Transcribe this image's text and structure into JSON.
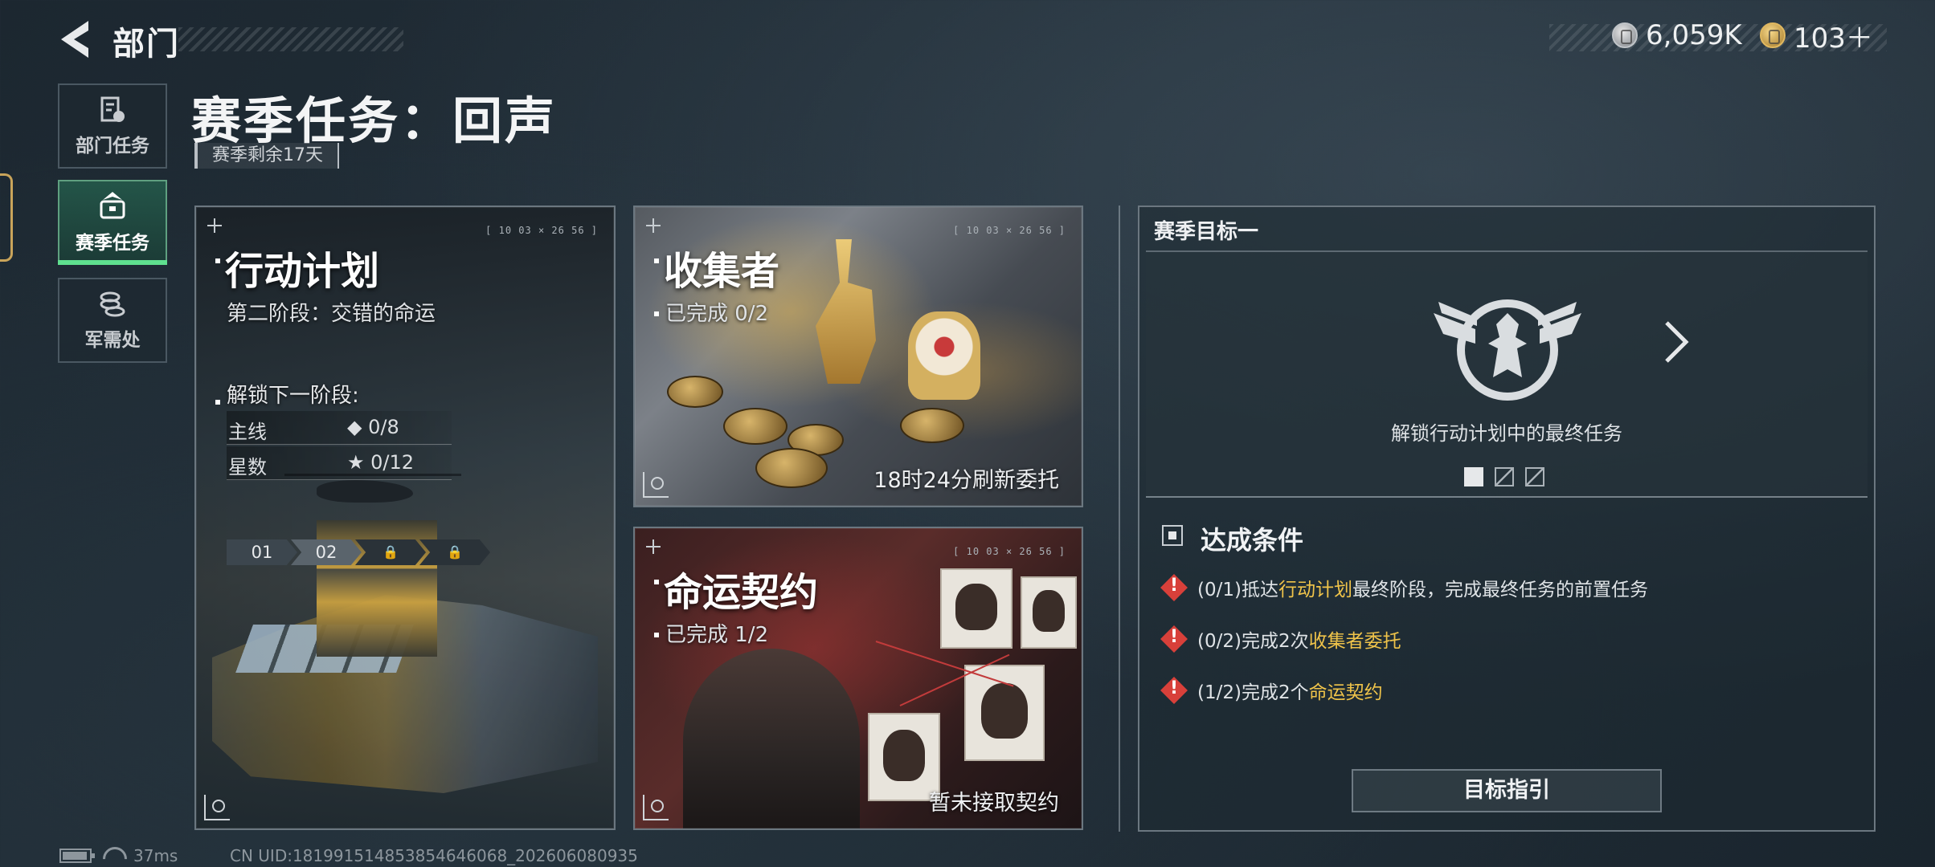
{
  "header": {
    "section_title": "部门",
    "currency": [
      {
        "icon": "silver-coin-icon",
        "value": "6,059K"
      },
      {
        "icon": "gold-coin-icon",
        "value": "103＋"
      }
    ]
  },
  "nav": {
    "items": [
      {
        "label": "部门任务",
        "icon": "task-clipboard-icon",
        "active": false
      },
      {
        "label": "赛季任务",
        "icon": "briefcase-icon",
        "active": true
      },
      {
        "label": "军需处",
        "icon": "coin-stack-icon",
        "active": false
      }
    ]
  },
  "page": {
    "title": "赛季任务：回声",
    "remaining": "赛季剩余17天"
  },
  "cards": {
    "operation": {
      "code": "[ 10 03  × 26 56 ]",
      "title": "行动计划",
      "stage": "第二阶段：交错的命运",
      "phases": [
        "01",
        "02",
        "🔒",
        "🔒"
      ],
      "unlock_label": "解锁下一阶段:",
      "main_label": "主线",
      "main_value": "◆ 0/8",
      "stars_label": "星数",
      "stars_value": "★ 0/12"
    },
    "collector": {
      "code": "[ 10 03  × 26 56 ]",
      "title": "收集者",
      "progress": "已完成 0/2",
      "refresh": "18时24分刷新委托"
    },
    "contract": {
      "code": "[ 10 03  × 26 56 ]",
      "title": "命运契约",
      "progress": "已完成 1/2",
      "status": "暂未接取契约"
    }
  },
  "goal": {
    "header": "赛季目标一",
    "description": "解锁行动计划中的最终任务",
    "conditions_title": "达成条件",
    "conditions": [
      {
        "prefix": "(0/1)抵达",
        "highlight": "行动计划",
        "suffix": "最终阶段，完成最终任务的前置任务"
      },
      {
        "prefix": "(0/2)完成2次",
        "highlight": "收集者委托",
        "suffix": ""
      },
      {
        "prefix": "(1/2)完成2个",
        "highlight": "命运契约",
        "suffix": ""
      }
    ],
    "guide_button": "目标指引"
  },
  "footer": {
    "ping": "37ms",
    "uid": "CN UID:181991514853854646068_202606080935"
  },
  "colors": {
    "accent_green": "#5fe08f",
    "highlight_yellow": "#f0c44a",
    "warning_red": "#d8403a"
  }
}
